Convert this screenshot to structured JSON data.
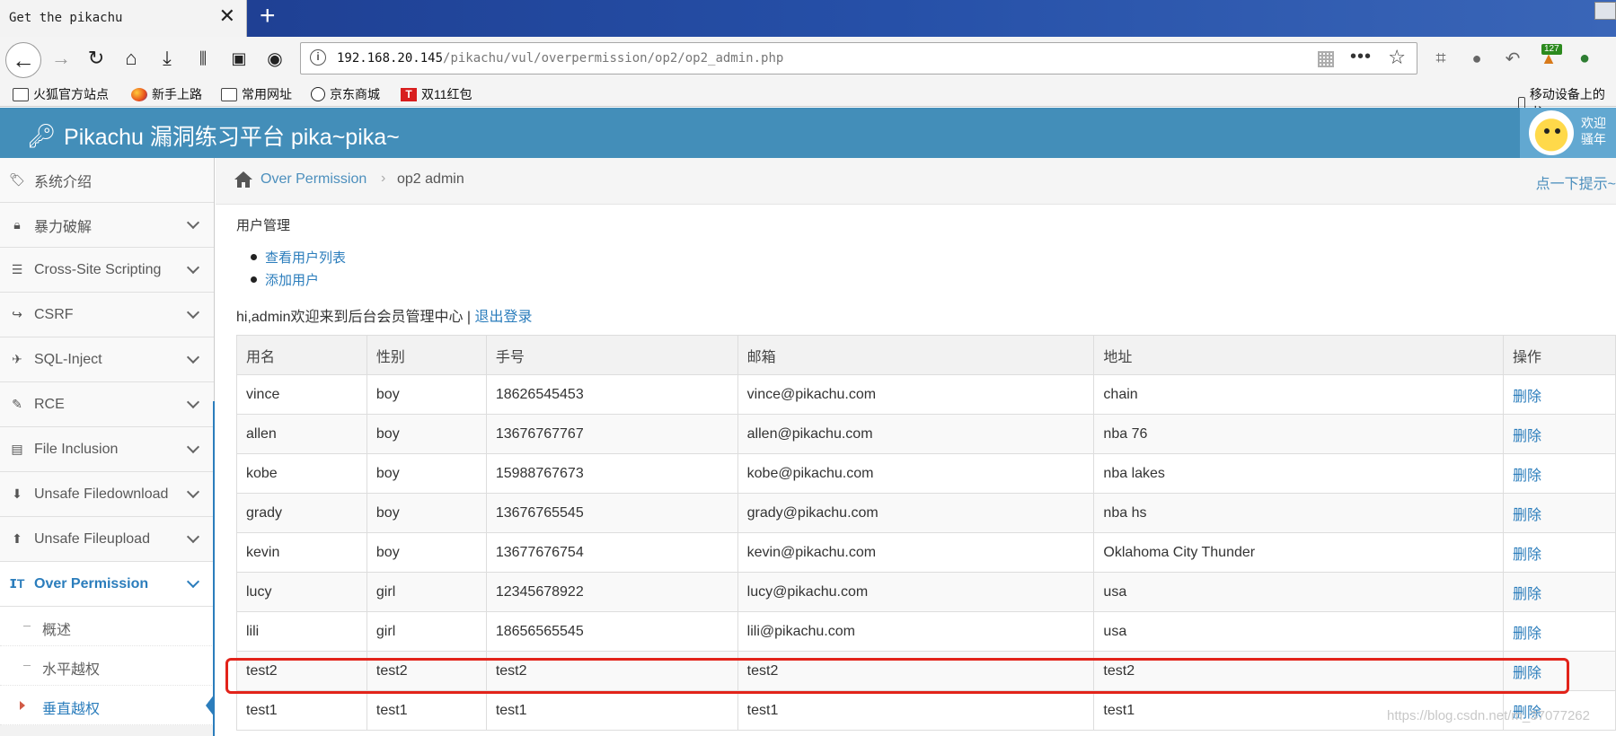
{
  "browser": {
    "tab_title": "Get the pikachu",
    "tab_close": "✕",
    "new_tab": "+",
    "url_host": "192.168.20.145",
    "url_path": "/pikachu/vul/overpermission/op2/op2_admin.php",
    "addon_badge": "127",
    "bookmarks": [
      "火狐官方站点",
      "新手上路",
      "常用网址",
      "京东商城",
      "双11红包"
    ],
    "tbadge_letter": "T",
    "mobile_bookmarks": "移动设备上的书"
  },
  "site": {
    "title": "Pikachu 漏洞练习平台 pika~pika~",
    "welcome_line1": "欢迎",
    "welcome_line2": "骚年"
  },
  "sidebar": {
    "items": [
      {
        "label": "系统介绍",
        "icon": "tags-icon"
      },
      {
        "label": "暴力破解",
        "icon": "lock-icon"
      },
      {
        "label": "Cross-Site Scripting",
        "icon": "list-icon"
      },
      {
        "label": "CSRF",
        "icon": "share-icon"
      },
      {
        "label": "SQL-Inject",
        "icon": "plane-icon"
      },
      {
        "label": "RCE",
        "icon": "pencil-icon"
      },
      {
        "label": "File Inclusion",
        "icon": "file-icon"
      },
      {
        "label": "Unsafe Filedownload",
        "icon": "download-icon"
      },
      {
        "label": "Unsafe Fileupload",
        "icon": "upload-icon"
      },
      {
        "label": "Over Permission",
        "icon": "text-height-icon"
      }
    ],
    "submenu": [
      "概述",
      "水平越权",
      "垂直越权"
    ]
  },
  "breadcrumb": {
    "section": "Over Permission",
    "separator": "›",
    "current": "op2 admin",
    "hint": "点一下提示~"
  },
  "content": {
    "section_title": "用户管理",
    "links": [
      "查看用户列表",
      "添加用户"
    ],
    "admin_greeting": "hi,admin欢迎来到后台会员管理中心 | ",
    "logout": "退出登录"
  },
  "table": {
    "headers": [
      "用名",
      "性别",
      "手号",
      "邮箱",
      "地址",
      "操作"
    ],
    "action_label": "删除",
    "rows": [
      [
        "vince",
        "boy",
        "18626545453",
        "vince@pikachu.com",
        "chain"
      ],
      [
        "allen",
        "boy",
        "13676767767",
        "allen@pikachu.com",
        "nba 76"
      ],
      [
        "kobe",
        "boy",
        "15988767673",
        "kobe@pikachu.com",
        "nba lakes"
      ],
      [
        "grady",
        "boy",
        "13676765545",
        "grady@pikachu.com",
        "nba hs"
      ],
      [
        "kevin",
        "boy",
        "13677676754",
        "kevin@pikachu.com",
        "Oklahoma City Thunder"
      ],
      [
        "lucy",
        "girl",
        "12345678922",
        "lucy@pikachu.com",
        "usa"
      ],
      [
        "lili",
        "girl",
        "18656565545",
        "lili@pikachu.com",
        "usa"
      ],
      [
        "test2",
        "test2",
        "test2",
        "test2",
        "test2"
      ],
      [
        "test1",
        "test1",
        "test1",
        "test1",
        "test1"
      ]
    ]
  },
  "watermark": "https://blog.csdn.net/m_37077262",
  "colors": {
    "header_blue": "#438eb9",
    "link_blue": "#2b7dbc",
    "highlight_red": "#e2231a"
  }
}
